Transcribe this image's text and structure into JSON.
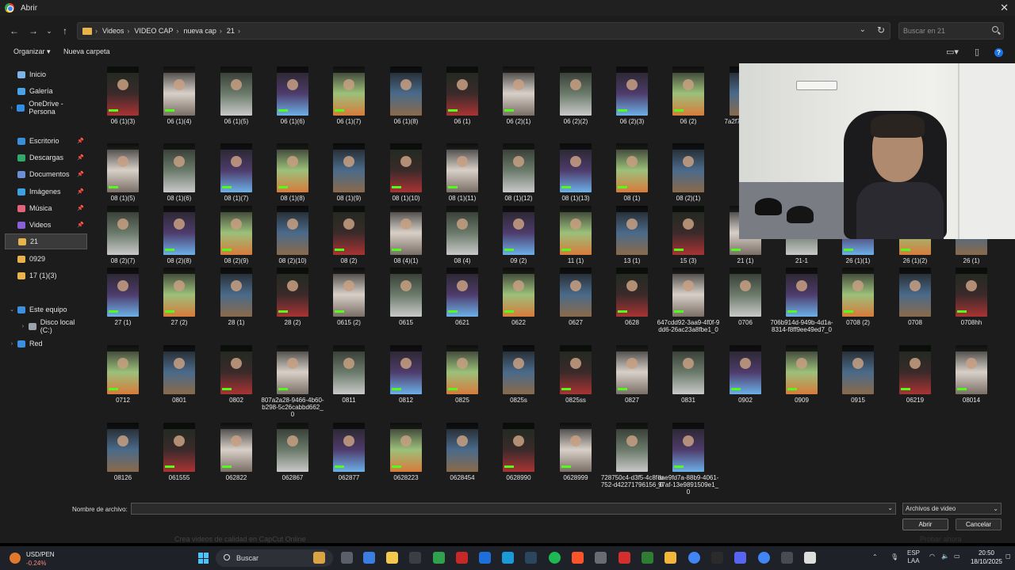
{
  "window": {
    "title": "Abrir",
    "close_glyph": "✕"
  },
  "address": {
    "crumbs": [
      "Videos",
      "VIDEO CAP",
      "nueva cap",
      "21"
    ],
    "search_placeholder": "Buscar en 21"
  },
  "toolbar": {
    "organize_label": "Organizar",
    "new_folder_label": "Nueva carpeta"
  },
  "sidebar": {
    "items": [
      {
        "label": "Inicio",
        "icon": "home-icon",
        "color": "#7fb3e8",
        "chev": ""
      },
      {
        "label": "Galería",
        "icon": "gallery-icon",
        "color": "#4aa3e8",
        "chev": ""
      },
      {
        "label": "OneDrive - Persona",
        "icon": "cloud-icon",
        "color": "#2f8fe6",
        "chev": "›"
      },
      {
        "label": "Escritorio",
        "icon": "desktop-icon",
        "color": "#3a8fd8",
        "pin": true
      },
      {
        "label": "Descargas",
        "icon": "download-icon",
        "color": "#33a86b",
        "pin": true
      },
      {
        "label": "Documentos",
        "icon": "document-icon",
        "color": "#6b8fd0",
        "pin": true
      },
      {
        "label": "Imágenes",
        "icon": "image-icon",
        "color": "#3da1e0",
        "pin": true
      },
      {
        "label": "Música",
        "icon": "music-icon",
        "color": "#e3637a",
        "pin": true
      },
      {
        "label": "Videos",
        "icon": "video-icon",
        "color": "#8a5fd8",
        "pin": true
      },
      {
        "label": "21",
        "icon": "folder-icon",
        "color": "#e8b34a",
        "selected": true
      },
      {
        "label": "0929",
        "icon": "folder-icon",
        "color": "#e8b34a"
      },
      {
        "label": "17 (1)(3)",
        "icon": "folder-icon",
        "color": "#e8b34a"
      },
      {
        "label": "Este equipo",
        "icon": "computer-icon",
        "color": "#3d8fe0",
        "chev": "⌄"
      },
      {
        "label": "Disco local (C:)",
        "icon": "drive-icon",
        "color": "#9aa3ad",
        "chev": "›"
      },
      {
        "label": "Red",
        "icon": "network-icon",
        "color": "#3d8fe0",
        "chev": "›"
      }
    ]
  },
  "files": [
    [
      "06 (1)(3)",
      "06 (1)(4)",
      "06 (1)(5)",
      "06 (1)(6)",
      "06 (1)(7)",
      "06 (1)(8)",
      "06 (1)",
      "06 (2)(1)",
      "06 (2)(2)",
      "06 (2)(3)",
      "06 (2)",
      "7a2f7 c91-9 bc"
    ],
    [
      "08 (1)(5)",
      "08 (1)(6)",
      "08 (1)(7)",
      "08 (1)(8)",
      "08 (1)(9)",
      "08 (1)(10)",
      "08 (1)(11)",
      "08 (1)(12)",
      "08 (1)(13)",
      "08 (1)",
      "08 (2)(1)"
    ],
    [
      "08 (2)(7)",
      "08 (2)(8)",
      "08 (2)(9)",
      "08 (2)(10)",
      "08 (2)",
      "08 (4)(1)",
      "08 (4)",
      "09 (2)",
      "11 (1)",
      "13 (1)",
      "15 (3)",
      "21 (1)",
      "21-1",
      "26 (1)(1)",
      "26 (1)(2)",
      "26 (1)"
    ],
    [
      "27 (1)",
      "27 (2)",
      "28 (1)",
      "28 (2)",
      "0615 (2)",
      "0615",
      "0621",
      "0622",
      "0627",
      "0628",
      "647cdd92-3aa9-4f0f-9dd6-26ac23a8fbe1_0",
      "0706",
      "706b914d-949b-4d1a-8314-f8ff9ee49ed7_0",
      "0708 (2)",
      "0708",
      "0708hh"
    ],
    [
      "0712",
      "0801",
      "0802",
      "807a2a28-9466-4b60-b298-5c26cabbd662_0",
      "0811",
      "0812",
      "0825",
      "0825s",
      "0825ss",
      "0827",
      "0831",
      "0902",
      "0909",
      "0915",
      "06219",
      "08014"
    ],
    [
      "08126",
      "061555",
      "062822",
      "062867",
      "062877",
      "0628223",
      "0628454",
      "0628990",
      "0628999",
      "728750c4-d3f5-4c8f-b752-d42271796156_0",
      "bae9fd7a-88b9-4061-97af-13e9891509e1_0"
    ]
  ],
  "bottom": {
    "filename_label": "Nombre de archivo:",
    "filename_value": "",
    "filetype_value": "Archivos de video",
    "open_label": "Abrir",
    "cancel_label": "Cancelar"
  },
  "behind": {
    "text": "Crea videos de calidad en CapCut Online",
    "right_text": "Probar ahora"
  },
  "taskbar": {
    "widget_symbol": "USD/PEN",
    "widget_change": "-0.24%",
    "search_label": "Buscar",
    "lang_top": "ESP",
    "lang_bottom": "LAA",
    "time": "20:50",
    "date": "18/10/2025"
  }
}
